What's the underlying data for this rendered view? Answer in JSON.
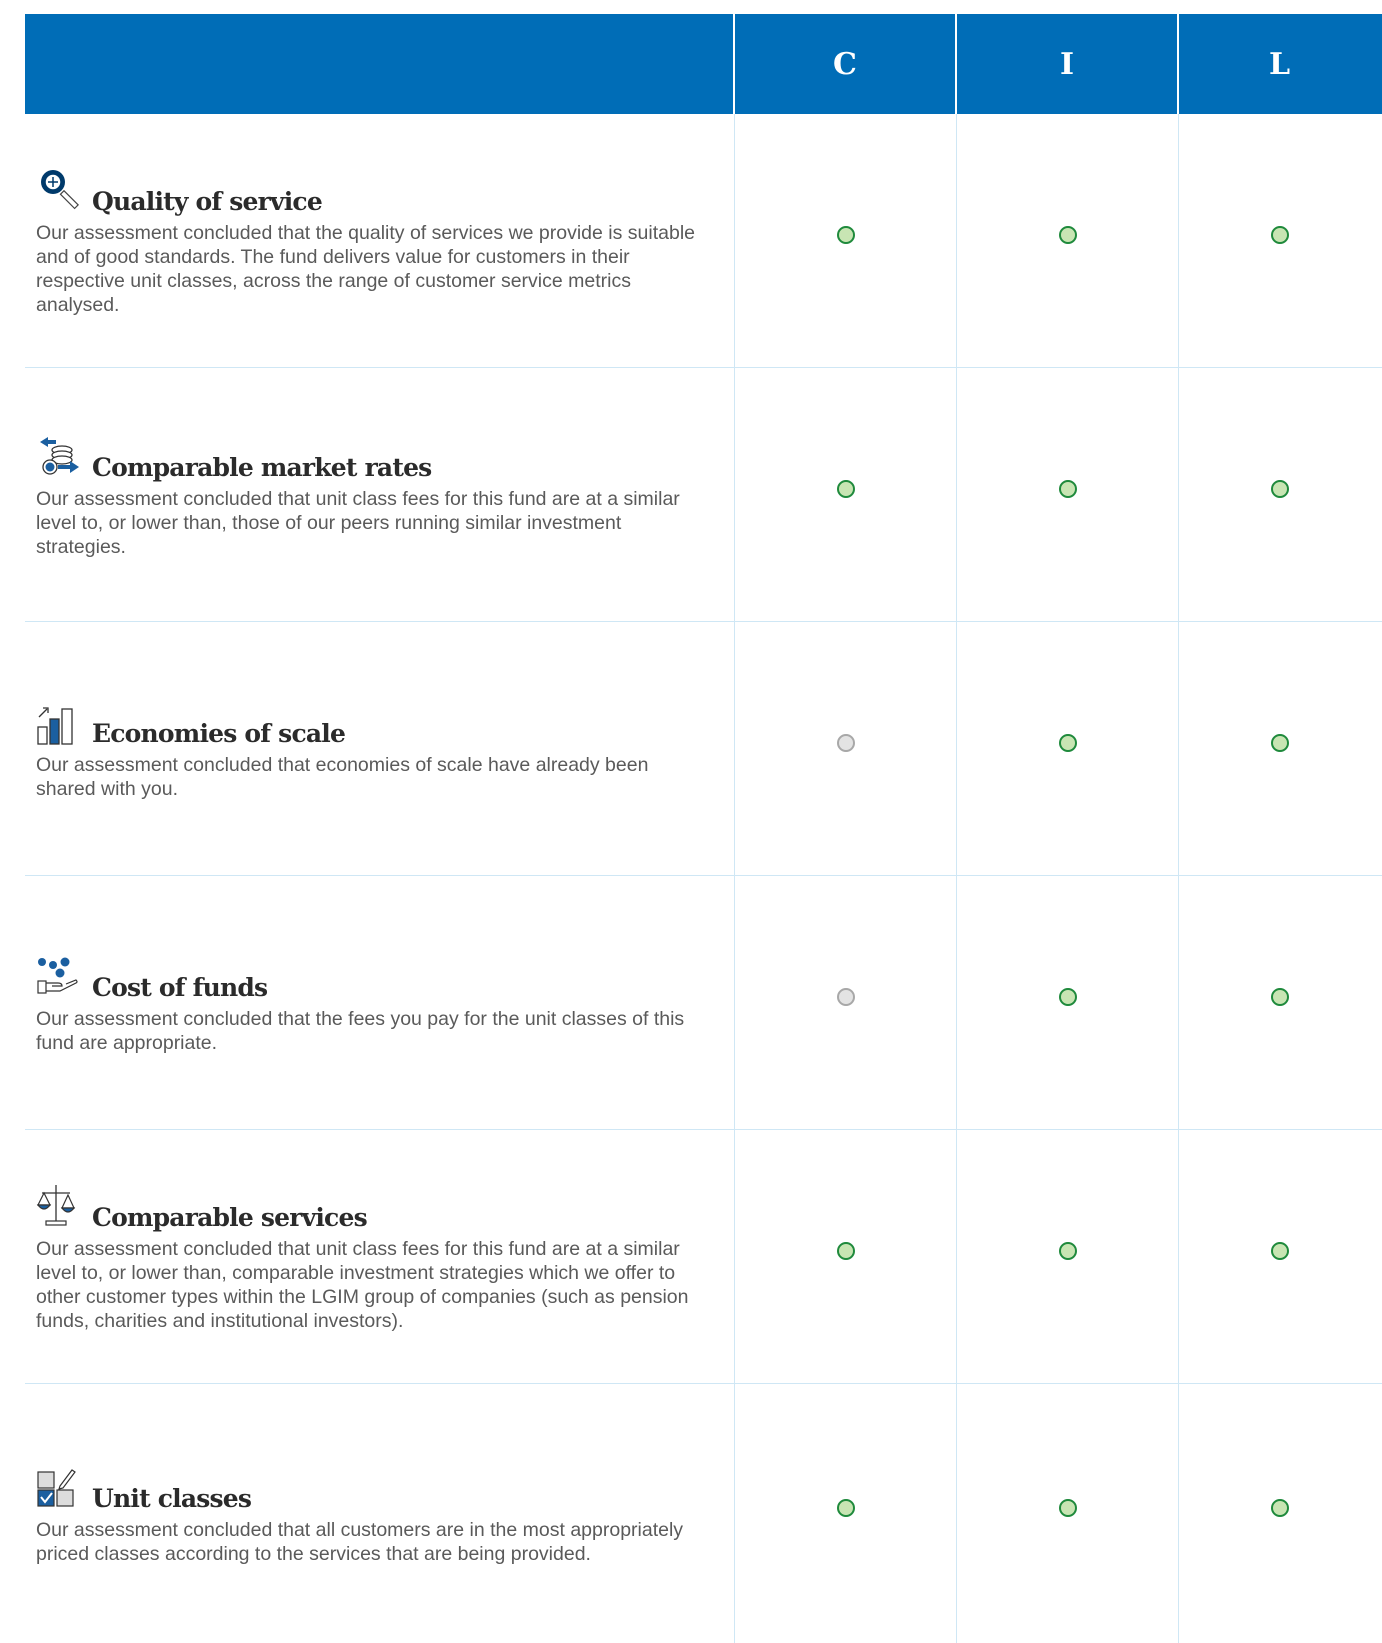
{
  "header": {
    "columns": [
      "C",
      "I",
      "L"
    ]
  },
  "colors": {
    "header_bg": "#006db7",
    "pass": "#1f8a3c",
    "neutral": "#a8a8a8"
  },
  "rows": [
    {
      "icon": "magnifier-icon",
      "title": "Quality of service",
      "description": "Our assessment concluded that the quality of services we provide is suitable and of good standards. The fund delivers value for customers in their respective unit classes, across the range of customer service metrics analysed.",
      "ratings": [
        "green",
        "green",
        "green"
      ]
    },
    {
      "icon": "coins-exchange-icon",
      "title": "Comparable market rates",
      "description": "Our assessment concluded that unit class fees for this fund are at a similar level to, or lower than, those of our peers running similar investment strategies.",
      "ratings": [
        "green",
        "green",
        "green"
      ]
    },
    {
      "icon": "bar-chart-icon",
      "title": "Economies of scale",
      "description": "Our assessment concluded that economies of scale have already been shared with you.",
      "ratings": [
        "grey",
        "green",
        "green"
      ]
    },
    {
      "icon": "hand-coins-icon",
      "title": "Cost of funds",
      "description": "Our assessment concluded that the fees you pay for the unit classes of this fund are appropriate.",
      "ratings": [
        "grey",
        "green",
        "green"
      ]
    },
    {
      "icon": "scales-icon",
      "title": "Comparable services",
      "description": "Our assessment concluded that unit class fees for this fund are at a similar level to, or lower than, comparable investment strategies which we offer to other customer types within the LGIM group of companies (such as pension funds, charities and institutional investors).",
      "ratings": [
        "green",
        "green",
        "green"
      ]
    },
    {
      "icon": "checkbox-grid-icon",
      "title": "Unit classes",
      "description": "Our assessment concluded that all customers are in the most appropriately priced classes according to the services that are being provided.",
      "ratings": [
        "green",
        "green",
        "green"
      ]
    }
  ]
}
